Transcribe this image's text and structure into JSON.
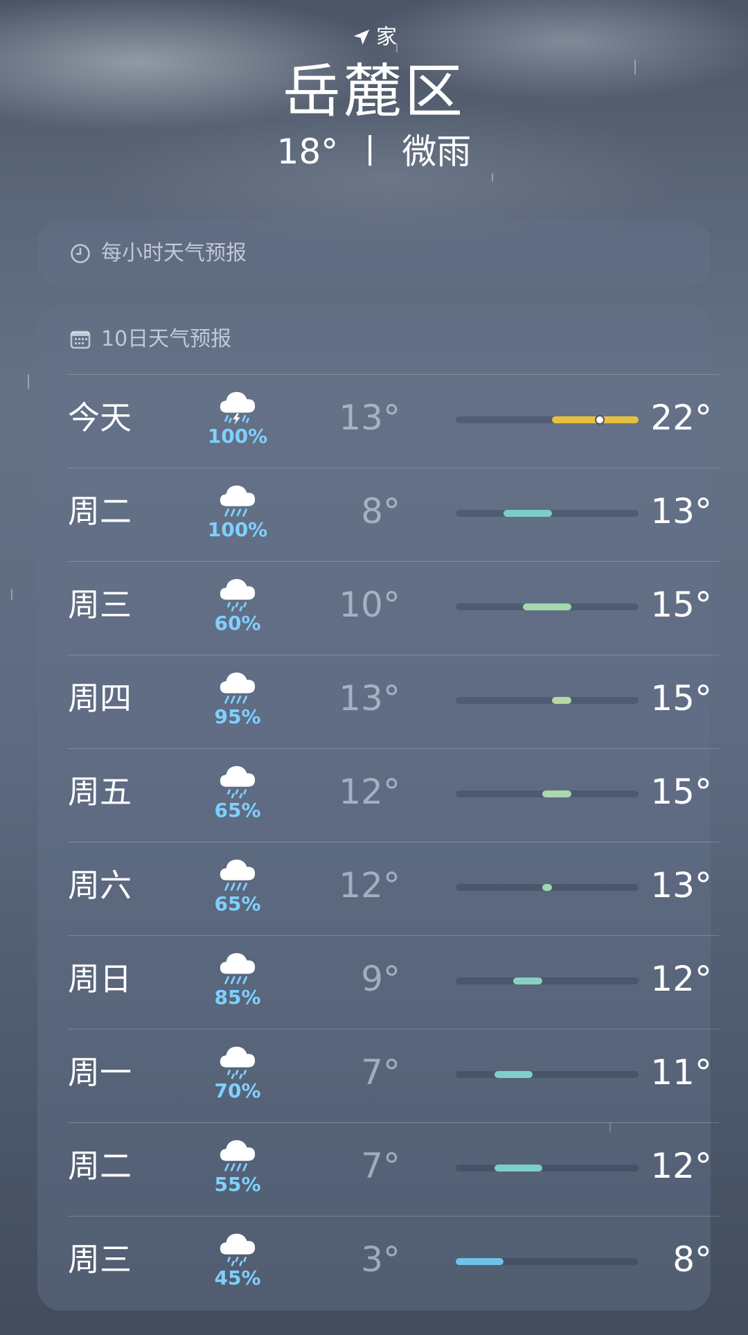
{
  "location": {
    "label": "家",
    "city": "岳麓区",
    "current_temp": "18°",
    "separator": "丨",
    "condition": "微雨"
  },
  "hourly_card": {
    "title": "每小时天气预报",
    "icon": "clock-icon"
  },
  "daily_card": {
    "title": "10日天气预报",
    "icon": "calendar-icon",
    "range_min": 3,
    "range_max": 22,
    "current_temp_value": 18,
    "days": [
      {
        "day": "今天",
        "icon": "thunderstorm-icon",
        "precip": "100%",
        "low": "13°",
        "high": "22°",
        "low_value": 13,
        "high_value": 22,
        "bar_color": "#e6c140",
        "current": true
      },
      {
        "day": "周二",
        "icon": "rain-icon",
        "precip": "100%",
        "low": "8°",
        "high": "13°",
        "low_value": 8,
        "high_value": 13,
        "bar_color": "#7ccfc8"
      },
      {
        "day": "周三",
        "icon": "drizzle-icon",
        "precip": "60%",
        "low": "10°",
        "high": "15°",
        "low_value": 10,
        "high_value": 15,
        "bar_color": "#a3d8b0"
      },
      {
        "day": "周四",
        "icon": "rain-icon",
        "precip": "95%",
        "low": "13°",
        "high": "15°",
        "low_value": 13,
        "high_value": 15,
        "bar_color": "#b6d9a2"
      },
      {
        "day": "周五",
        "icon": "drizzle-icon",
        "precip": "65%",
        "low": "12°",
        "high": "15°",
        "low_value": 12,
        "high_value": 15,
        "bar_color": "#aad7ac"
      },
      {
        "day": "周六",
        "icon": "rain-icon",
        "precip": "65%",
        "low": "12°",
        "high": "13°",
        "low_value": 12,
        "high_value": 13,
        "bar_color": "#9fd6b3"
      },
      {
        "day": "周日",
        "icon": "rain-icon",
        "precip": "85%",
        "low": "9°",
        "high": "12°",
        "low_value": 9,
        "high_value": 12,
        "bar_color": "#86d2c2"
      },
      {
        "day": "周一",
        "icon": "drizzle-icon",
        "precip": "70%",
        "low": "7°",
        "high": "11°",
        "low_value": 7,
        "high_value": 11,
        "bar_color": "#7fcfc9"
      },
      {
        "day": "周二",
        "icon": "rain-icon",
        "precip": "55%",
        "low": "7°",
        "high": "12°",
        "low_value": 7,
        "high_value": 12,
        "bar_color": "#7ccfca"
      },
      {
        "day": "周三",
        "icon": "drizzle-icon",
        "precip": "45%",
        "low": "3°",
        "high": "8°",
        "low_value": 3,
        "high_value": 8,
        "bar_color": "#6ec4e6"
      }
    ]
  }
}
